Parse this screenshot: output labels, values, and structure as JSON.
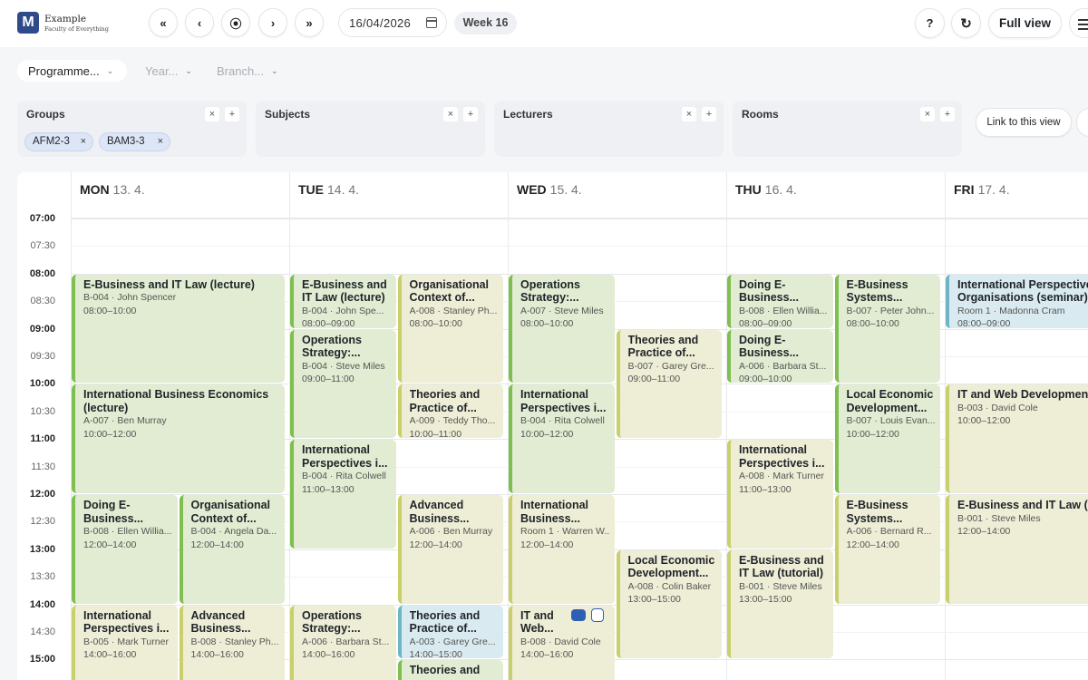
{
  "brand": {
    "logo_letter": "M",
    "name": "Example",
    "subtitle": "Faculty of Everything"
  },
  "nav": {
    "first": "«",
    "prev": "‹",
    "today": "⦿",
    "next": "›",
    "last": "»"
  },
  "date": {
    "value": "16/04/2026",
    "week": "Week 16"
  },
  "actions": {
    "help": "?",
    "refresh": "↻",
    "full_view": "Full view",
    "link_view": "Link to this view"
  },
  "filters": {
    "programme": "Programme...",
    "year": "Year...",
    "branch": "Branch..."
  },
  "panels": {
    "groups": {
      "title": "Groups",
      "chips": [
        "AFM2-3",
        "BAM3-3"
      ]
    },
    "subjects": {
      "title": "Subjects"
    },
    "lecturers": {
      "title": "Lecturers"
    },
    "rooms": {
      "title": "Rooms"
    }
  },
  "days": [
    {
      "name": "MON",
      "date": "13. 4."
    },
    {
      "name": "TUE",
      "date": "14. 4."
    },
    {
      "name": "WED",
      "date": "15. 4."
    },
    {
      "name": "THU",
      "date": "16. 4."
    },
    {
      "name": "FRI",
      "date": "17. 4."
    }
  ],
  "times": [
    "07:00",
    "07:30",
    "08:00",
    "08:30",
    "09:00",
    "09:30",
    "10:00",
    "10:30",
    "11:00",
    "11:30",
    "12:00",
    "12:30",
    "13:00",
    "13:30",
    "14:00",
    "14:30",
    "15:00"
  ],
  "events": [
    {
      "day": 0,
      "lane": 0,
      "lanes": 1,
      "start": "08:00",
      "end": "10:00",
      "color": "g",
      "title": "E-Business and IT Law (lecture)",
      "detail": "B-004 · John Spencer",
      "time": "08:00–10:00"
    },
    {
      "day": 0,
      "lane": 0,
      "lanes": 1,
      "start": "10:00",
      "end": "12:00",
      "color": "g",
      "title": "International Business Economics (lecture)",
      "detail": "A-007 · Ben Murray",
      "time": "10:00–12:00"
    },
    {
      "day": 0,
      "lane": 0,
      "lanes": 2,
      "start": "12:00",
      "end": "14:00",
      "color": "g",
      "title": "Doing E-Business...",
      "detail": "B-008 · Ellen Willia...",
      "time": "12:00–14:00"
    },
    {
      "day": 0,
      "lane": 1,
      "lanes": 2,
      "start": "12:00",
      "end": "14:00",
      "color": "g",
      "title": "Organisational Context of...",
      "detail": "B-004 · Angela Da...",
      "time": "12:00–14:00"
    },
    {
      "day": 0,
      "lane": 0,
      "lanes": 2,
      "start": "14:00",
      "end": "16:00",
      "color": "y",
      "title": "International Perspectives i...",
      "detail": "B-005 · Mark Turner",
      "time": "14:00–16:00"
    },
    {
      "day": 0,
      "lane": 1,
      "lanes": 2,
      "start": "14:00",
      "end": "16:00",
      "color": "y",
      "title": "Advanced Business...",
      "detail": "B-008 · Stanley Ph...",
      "time": "14:00–16:00"
    },
    {
      "day": 1,
      "lane": 0,
      "lanes": 2,
      "start": "08:00",
      "end": "09:00",
      "color": "g",
      "title": "E-Business and IT Law (lecture)",
      "detail": "B-004 · John Spe...",
      "time": "08:00–09:00"
    },
    {
      "day": 1,
      "lane": 1,
      "lanes": 2,
      "start": "08:00",
      "end": "10:00",
      "color": "y",
      "title": "Organisational Context of...",
      "detail": "A-008 · Stanley Ph...",
      "time": "08:00–10:00"
    },
    {
      "day": 1,
      "lane": 0,
      "lanes": 2,
      "start": "09:00",
      "end": "11:00",
      "color": "g",
      "title": "Operations Strategy:...",
      "detail": "B-004 · Steve Miles",
      "time": "09:00–11:00"
    },
    {
      "day": 1,
      "lane": 1,
      "lanes": 2,
      "start": "10:00",
      "end": "11:00",
      "color": "y",
      "title": "Theories and Practice of...",
      "detail": "A-009 · Teddy Tho...",
      "time": "10:00–11:00"
    },
    {
      "day": 1,
      "lane": 0,
      "lanes": 2,
      "start": "11:00",
      "end": "13:00",
      "color": "g",
      "title": "International Perspectives i...",
      "detail": "B-004 · Rita Colwell",
      "time": "11:00–13:00"
    },
    {
      "day": 1,
      "lane": 1,
      "lanes": 2,
      "start": "12:00",
      "end": "14:00",
      "color": "y",
      "title": "Advanced Business...",
      "detail": "A-006 · Ben Murray",
      "time": "12:00–14:00"
    },
    {
      "day": 1,
      "lane": 0,
      "lanes": 2,
      "start": "14:00",
      "end": "16:00",
      "color": "y",
      "title": "Operations Strategy:...",
      "detail": "A-006 · Barbara St...",
      "time": "14:00–16:00"
    },
    {
      "day": 1,
      "lane": 1,
      "lanes": 2,
      "start": "14:00",
      "end": "15:00",
      "color": "b",
      "title": "Theories and Practice of...",
      "detail": "A-003 · Garey Gre...",
      "time": "14:00–15:00"
    },
    {
      "day": 1,
      "lane": 1,
      "lanes": 2,
      "start": "15:00",
      "end": "16:00",
      "color": "g",
      "title": "Theories and",
      "detail": "",
      "time": ""
    },
    {
      "day": 2,
      "lane": 0,
      "lanes": 2,
      "start": "08:00",
      "end": "10:00",
      "color": "g",
      "title": "Operations Strategy:...",
      "detail": "A-007 · Steve Miles",
      "time": "08:00–10:00"
    },
    {
      "day": 2,
      "lane": 1,
      "lanes": 2,
      "start": "09:00",
      "end": "11:00",
      "color": "y",
      "title": "Theories and Practice of...",
      "detail": "B-007 · Garey Gre...",
      "time": "09:00–11:00"
    },
    {
      "day": 2,
      "lane": 0,
      "lanes": 2,
      "start": "10:00",
      "end": "12:00",
      "color": "g",
      "title": "International Perspectives i...",
      "detail": "B-004 · Rita Colwell",
      "time": "10:00–12:00"
    },
    {
      "day": 2,
      "lane": 0,
      "lanes": 2,
      "start": "12:00",
      "end": "14:00",
      "color": "y",
      "title": "International Business...",
      "detail": "Room 1 · Warren W...",
      "time": "12:00–14:00"
    },
    {
      "day": 2,
      "lane": 1,
      "lanes": 2,
      "start": "13:00",
      "end": "15:00",
      "color": "y",
      "title": "Local Economic Development...",
      "detail": "A-008 · Colin Baker",
      "time": "13:00–15:00"
    },
    {
      "day": 2,
      "lane": 0,
      "lanes": 2,
      "start": "14:00",
      "end": "16:00",
      "color": "y",
      "title": "IT and Web...",
      "detail": "B-008 · David Cole",
      "time": "14:00–16:00",
      "badges": true
    },
    {
      "day": 3,
      "lane": 0,
      "lanes": 2,
      "start": "08:00",
      "end": "09:00",
      "color": "g",
      "title": "Doing E-Business...",
      "detail": "B-008 · Ellen Willia...",
      "time": "08:00–09:00"
    },
    {
      "day": 3,
      "lane": 1,
      "lanes": 2,
      "start": "08:00",
      "end": "10:00",
      "color": "g",
      "title": "E-Business Systems...",
      "detail": "B-007 · Peter John...",
      "time": "08:00–10:00"
    },
    {
      "day": 3,
      "lane": 0,
      "lanes": 2,
      "start": "09:00",
      "end": "10:00",
      "color": "g",
      "title": "Doing E-Business...",
      "detail": "A-006 · Barbara St...",
      "time": "09:00–10:00"
    },
    {
      "day": 3,
      "lane": 1,
      "lanes": 2,
      "start": "10:00",
      "end": "12:00",
      "color": "g",
      "title": "Local Economic Development...",
      "detail": "B-007 · Louis Evan...",
      "time": "10:00–12:00"
    },
    {
      "day": 3,
      "lane": 0,
      "lanes": 2,
      "start": "11:00",
      "end": "13:00",
      "color": "y",
      "title": "International Perspectives i...",
      "detail": "A-008 · Mark Turner",
      "time": "11:00–13:00"
    },
    {
      "day": 3,
      "lane": 1,
      "lanes": 2,
      "start": "12:00",
      "end": "14:00",
      "color": "y",
      "title": "E-Business Systems...",
      "detail": "A-006 · Bernard R...",
      "time": "12:00–14:00"
    },
    {
      "day": 3,
      "lane": 0,
      "lanes": 2,
      "start": "13:00",
      "end": "15:00",
      "color": "y",
      "title": "E-Business and IT Law (tutorial)",
      "detail": "B-001 · Steve Miles",
      "time": "13:00–15:00"
    },
    {
      "day": 4,
      "lane": 0,
      "lanes": 1,
      "start": "08:00",
      "end": "09:00",
      "color": "b",
      "title": "International Perspectives Organisations (seminar)",
      "detail": "Room 1 · Madonna Cram",
      "time": "08:00–09:00"
    },
    {
      "day": 4,
      "lane": 0,
      "lanes": 1,
      "start": "10:00",
      "end": "12:00",
      "color": "y",
      "title": "IT and Web Development - (tutorial)",
      "detail": "B-003 · David Cole",
      "time": "10:00–12:00"
    },
    {
      "day": 4,
      "lane": 0,
      "lanes": 1,
      "start": "12:00",
      "end": "14:00",
      "color": "y",
      "title": "E-Business and IT Law (tu",
      "detail": "B-001 · Steve Miles",
      "time": "12:00–14:00"
    }
  ]
}
